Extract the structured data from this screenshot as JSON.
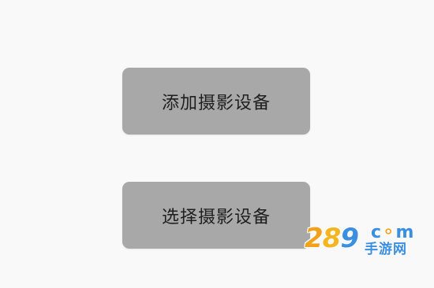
{
  "buttons": {
    "add_label": "添加摄影设备",
    "select_label": "选择摄影设备"
  },
  "watermark": {
    "digit_1": "2",
    "digit_2": "8",
    "digit_3": "9",
    "domain": "c",
    "domain_mid": "⚬",
    "domain_end": "m",
    "subtitle": "手游网"
  },
  "colors": {
    "background": "#f9f9f9",
    "button_fill": "#a8a8a8",
    "button_text": "#1f1f1f",
    "watermark_orange": "#f2a11c",
    "watermark_blue": "#3b8fe0"
  }
}
